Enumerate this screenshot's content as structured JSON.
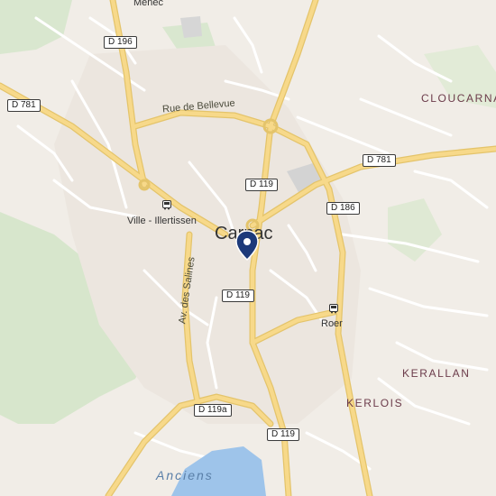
{
  "city": "Carnac",
  "places": {
    "cloucarnac": "CLOUCARNAC",
    "kerallan": "KERALLAN",
    "kerlois": "KERLOIS",
    "menec": "Menec"
  },
  "water": "Anciens",
  "bus_stops": {
    "ville": "Ville - Illertissen",
    "roer": "Roer"
  },
  "streets": {
    "bellevue": "Rue de Bellevue",
    "salines": "Av. des Salines"
  },
  "shields": {
    "d196": "D 196",
    "d781_west": "D 781",
    "d781_east": "D 781",
    "d119_north": "D 119",
    "d186": "D 186",
    "d119_center": "D 119",
    "d119a": "D 119a",
    "d119_south": "D 119"
  },
  "colors": {
    "land": "#f1ede7",
    "park": "#cfe3c4",
    "major_road": "#f6d27a",
    "minor_road": "#ffffff",
    "water": "#9ec4ea",
    "marker": "#1d3a7a"
  },
  "icons": {
    "marker": "location-pin-icon",
    "bus": "bus-stop-icon"
  }
}
